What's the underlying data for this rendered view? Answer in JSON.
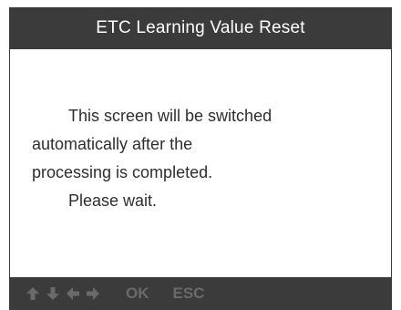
{
  "header": {
    "title": "ETC Learning Value Reset"
  },
  "message": {
    "line1": "This screen will be switched",
    "line2": "automatically after the",
    "line3": "processing is completed.",
    "line4": "Please wait."
  },
  "footer": {
    "icons": [
      "arrow-up-icon",
      "arrow-down-icon",
      "arrow-left-icon",
      "arrow-right-icon"
    ],
    "ok_label": "OK",
    "esc_label": "ESC"
  },
  "colors": {
    "bar": "#3b3b3b",
    "title_text": "#ffffff",
    "body_text": "#2e2e2e",
    "footer_text": "#6a6a6a"
  }
}
